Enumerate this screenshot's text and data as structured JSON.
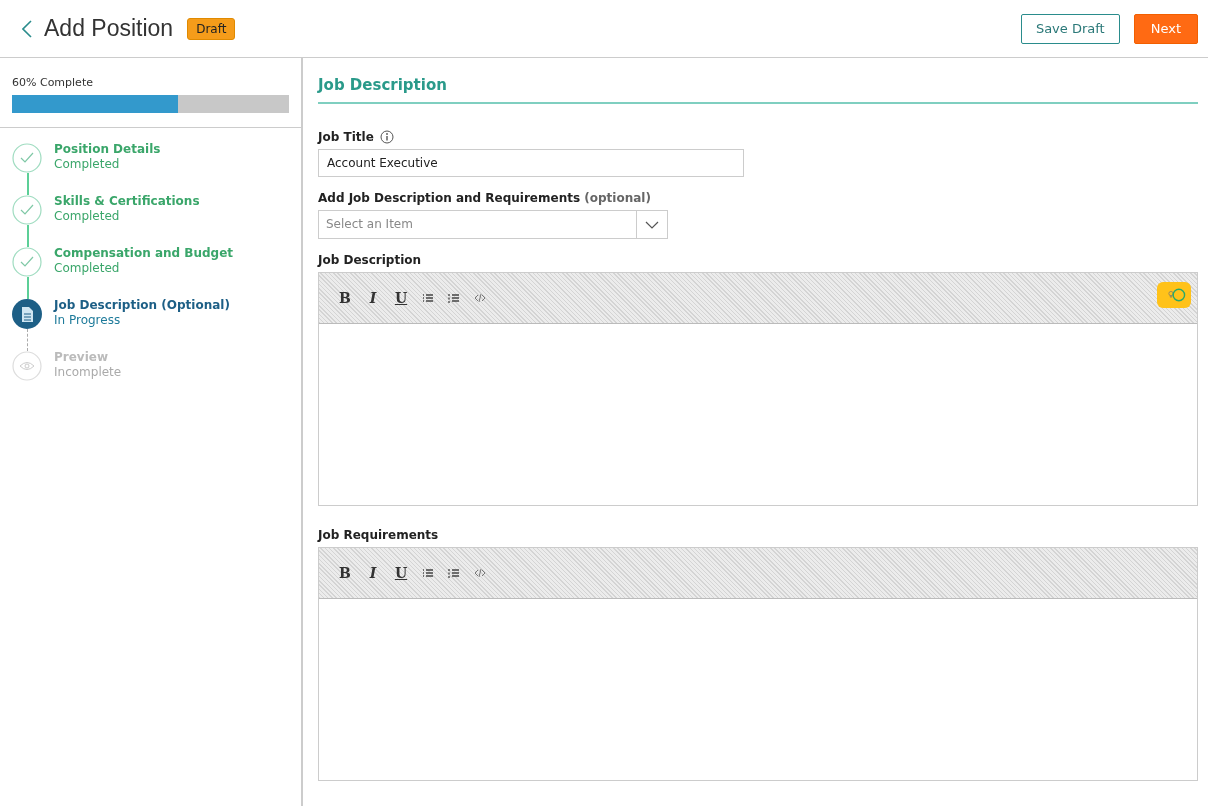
{
  "header": {
    "title": "Add Position",
    "badge": "Draft",
    "buttons": [
      {
        "label": "Save Draft",
        "kind": "secondary"
      },
      {
        "label": "Next",
        "kind": "primary"
      }
    ]
  },
  "progress": {
    "label": "60% Complete",
    "level": 0.6
  },
  "steps": [
    {
      "title": "Position Details",
      "status": "Completed",
      "kind": "completed"
    },
    {
      "title": "Skills & Certifications",
      "status": "Completed",
      "kind": "completed"
    },
    {
      "title": "Compensation and Budget",
      "status": "Completed",
      "kind": "completed"
    },
    {
      "title": "Job Description (Optional)",
      "status": "In Progress",
      "kind": "current"
    },
    {
      "title": "Preview",
      "status": "Incomplete",
      "kind": "incomplete"
    }
  ],
  "section_title": "Job Description",
  "job_title": {
    "label": "Job Title",
    "value": "Account Executive"
  },
  "template_select": {
    "label": "Add Job Description and Requirements **(optional)**",
    "placeholder": "Select an Item"
  },
  "editors": [
    {
      "label": "Job Description",
      "toolbar": [
        "B",
        "I",
        "U"
      ],
      "ai_toggle": true
    },
    {
      "label": "Job Requirements",
      "toolbar": [
        "B",
        "I",
        "U"
      ],
      "ai_toggle": false
    }
  ]
}
